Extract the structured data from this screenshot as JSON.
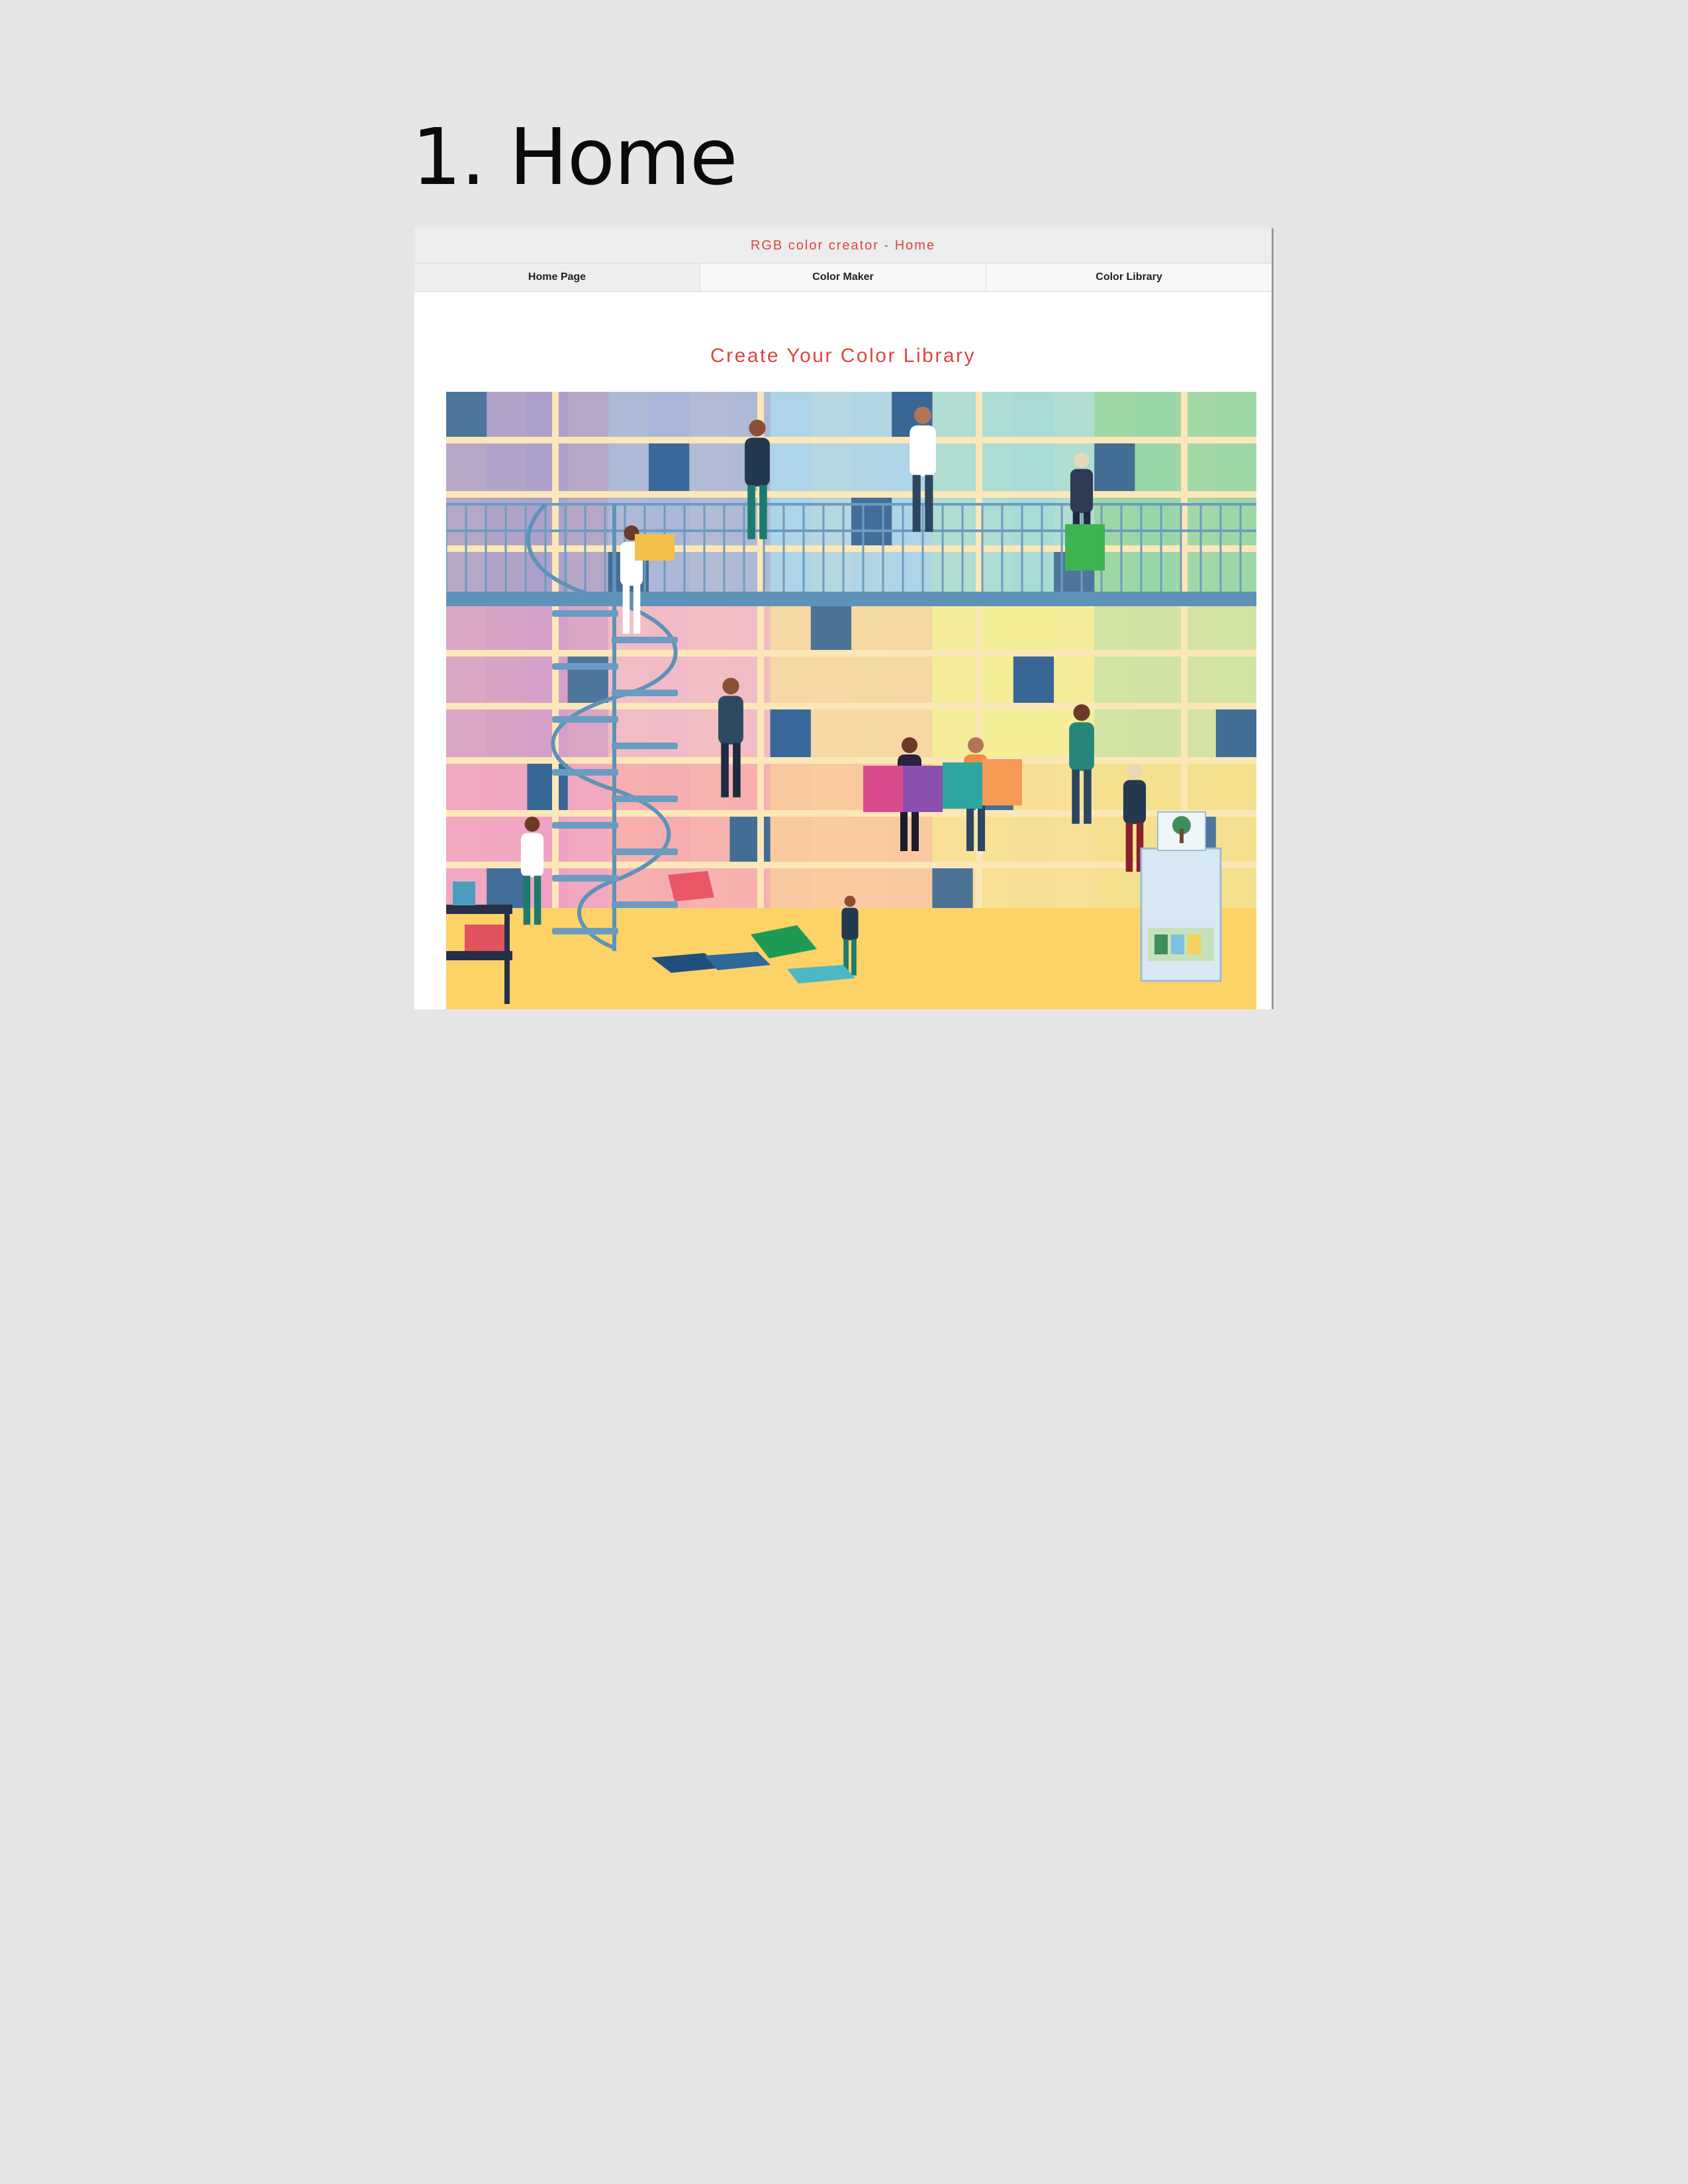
{
  "heading": "1. Home",
  "app": {
    "window_title": "RGB color creator - Home",
    "accent_color": "#e0443e"
  },
  "nav": {
    "tabs": [
      {
        "label": "Home Page",
        "active": true
      },
      {
        "label": "Color Maker",
        "active": false
      },
      {
        "label": "Color Library",
        "active": false
      }
    ]
  },
  "main": {
    "title": "Create Your Color Library"
  },
  "hero": {
    "subject": "illustration of people arranging colorful swatches on library shelves"
  }
}
